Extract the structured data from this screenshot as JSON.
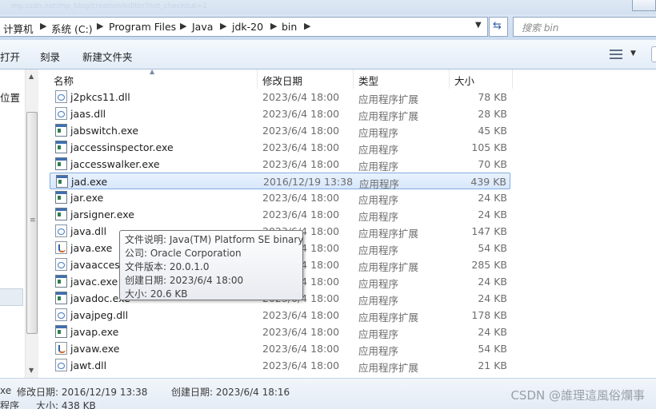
{
  "window": {
    "faint_title": "mp.csdn.net/mp_blog/creation/editor?not_checkout=1"
  },
  "breadcrumb": {
    "items": [
      "计算机",
      "系统 (C:)",
      "Program Files",
      "Java",
      "jdk-20",
      "bin"
    ]
  },
  "search": {
    "placeholder": "搜索 bin"
  },
  "toolbar": {
    "open_label": "打开",
    "burn_label": "刻录",
    "new_folder_label": "新建文件夹"
  },
  "nav": {
    "location_label": "位置"
  },
  "columns": {
    "name": "名称",
    "date": "修改日期",
    "type": "类型",
    "size": "大小"
  },
  "files": [
    {
      "name": "j2pkcs11.dll",
      "date": "2023/6/4 18:00",
      "type": "应用程序扩展",
      "size": "78 KB",
      "icon": "dll-icon"
    },
    {
      "name": "jaas.dll",
      "date": "2023/6/4 18:00",
      "type": "应用程序扩展",
      "size": "28 KB",
      "icon": "dll-icon"
    },
    {
      "name": "jabswitch.exe",
      "date": "2023/6/4 18:00",
      "type": "应用程序",
      "size": "45 KB",
      "icon": "exe-icon"
    },
    {
      "name": "jaccessinspector.exe",
      "date": "2023/6/4 18:00",
      "type": "应用程序",
      "size": "105 KB",
      "icon": "exe-icon"
    },
    {
      "name": "jaccesswalker.exe",
      "date": "2023/6/4 18:00",
      "type": "应用程序",
      "size": "70 KB",
      "icon": "exe-icon"
    },
    {
      "name": "jad.exe",
      "date": "2016/12/19 13:38",
      "type": "应用程序",
      "size": "439 KB",
      "icon": "exe-icon",
      "selected": true
    },
    {
      "name": "jar.exe",
      "date": "2023/6/4 18:00",
      "type": "应用程序",
      "size": "24 KB",
      "icon": "exe-icon"
    },
    {
      "name": "jarsigner.exe",
      "date": "2023/6/4 18:00",
      "type": "应用程序",
      "size": "24 KB",
      "icon": "exe-icon"
    },
    {
      "name": "java.dll",
      "date": "2023/6/4 18:00",
      "type": "应用程序扩展",
      "size": "147 KB",
      "icon": "dll-icon"
    },
    {
      "name": "java.exe",
      "date": "2023/6/4 18:00",
      "type": "应用程序",
      "size": "54 KB",
      "icon": "java-icon"
    },
    {
      "name": "javaaccess",
      "date": "2023/6/4 18:00",
      "type": "应用程序扩展",
      "size": "285 KB",
      "icon": "dll-icon"
    },
    {
      "name": "javac.exe",
      "date": "2023/6/4 18:00",
      "type": "应用程序",
      "size": "24 KB",
      "icon": "exe-icon"
    },
    {
      "name": "javadoc.exe",
      "date": "2023/6/4 18:00",
      "type": "应用程序",
      "size": "24 KB",
      "icon": "exe-icon"
    },
    {
      "name": "javajpeg.dll",
      "date": "2023/6/4 18:00",
      "type": "应用程序扩展",
      "size": "178 KB",
      "icon": "dll-icon"
    },
    {
      "name": "javap.exe",
      "date": "2023/6/4 18:00",
      "type": "应用程序",
      "size": "24 KB",
      "icon": "exe-icon"
    },
    {
      "name": "javaw.exe",
      "date": "2023/6/4 18:00",
      "type": "应用程序",
      "size": "54 KB",
      "icon": "java-icon"
    },
    {
      "name": "jawt.dll",
      "date": "2023/6/4 18:00",
      "type": "应用程序扩展",
      "size": "21 KB",
      "icon": "dll-icon"
    }
  ],
  "tooltip": {
    "description": "文件说明: Java(TM) Platform SE binary",
    "company": "公司: Oracle Corporation",
    "version": "文件版本: 20.0.1.0",
    "created": "创建日期: 2023/6/4 18:00",
    "size": "大小: 20.6 KB"
  },
  "status": {
    "name_fragment": "xe",
    "type_fragment": "程序",
    "modified": "修改日期: 2016/12/19 13:38",
    "created": "创建日期: 2023/6/4 18:16",
    "size": "大小: 438 KB"
  },
  "watermark": "CSDN @誰理這風俗爛事",
  "colors": {
    "selection_border": "#84acdd",
    "selection_fill": "#dbe9fb",
    "chrome": "#dbe6f4"
  }
}
